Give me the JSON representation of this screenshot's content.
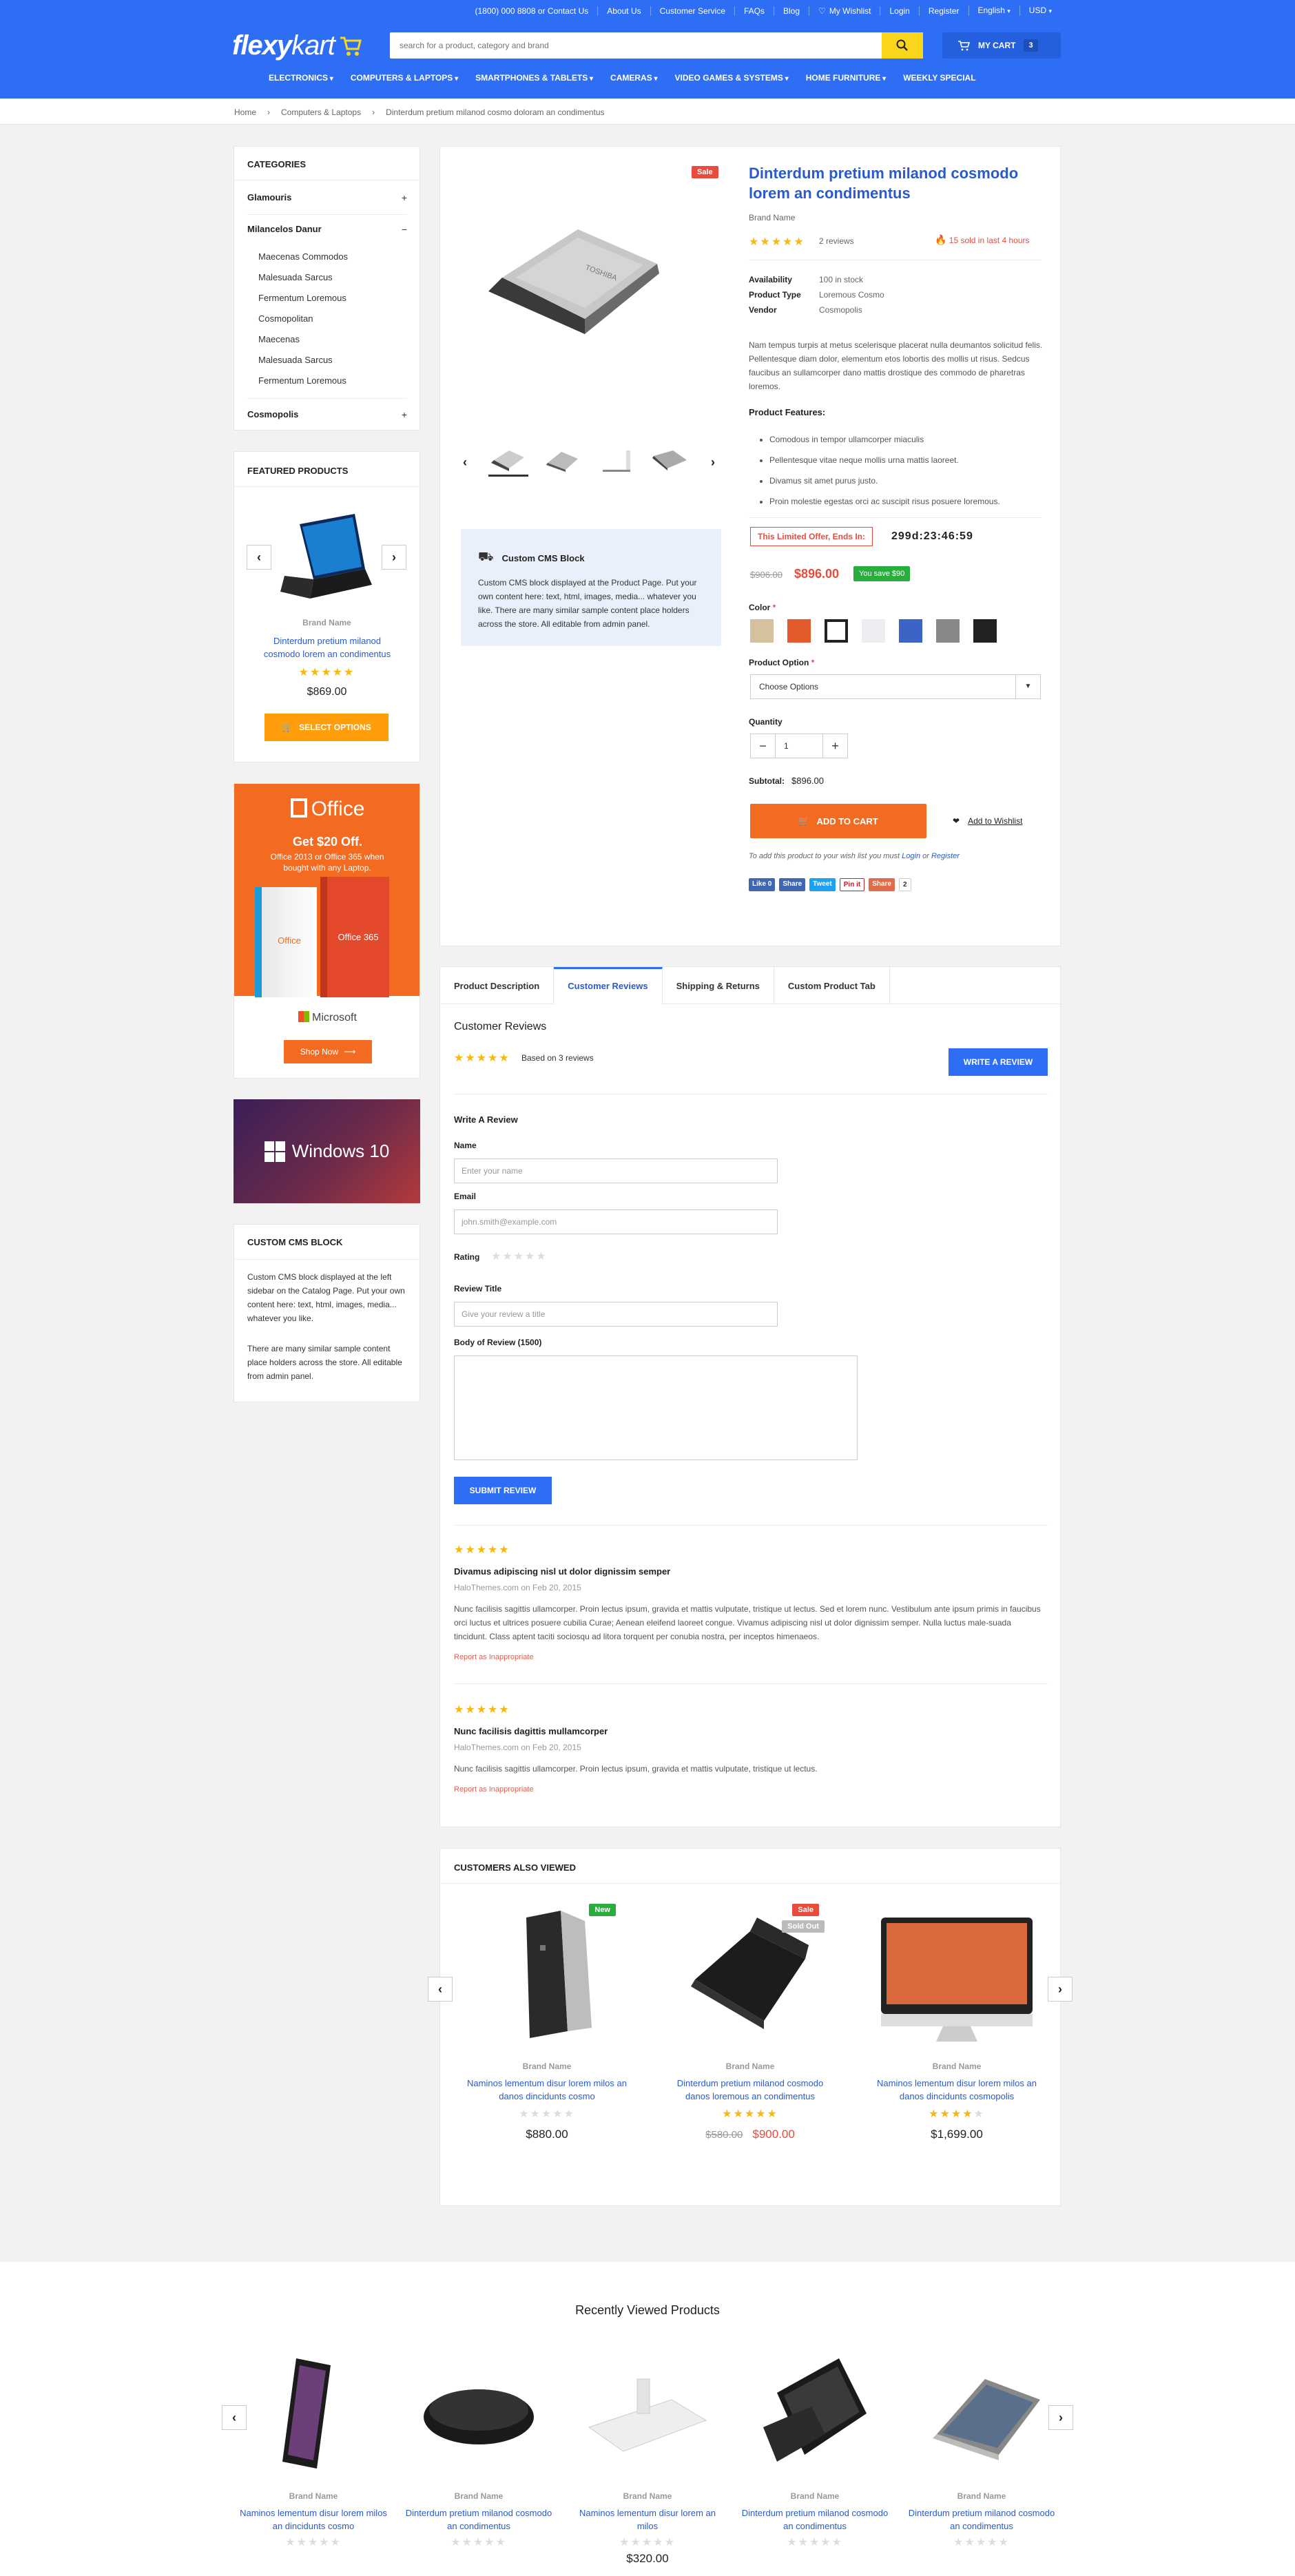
{
  "topbar": {
    "phone": "(1800) 000 8808 or Contact Us",
    "about": "About Us",
    "service": "Customer Service",
    "faqs": "FAQs",
    "blog": "Blog",
    "wishlist": "My Wishlist",
    "login": "Login",
    "register": "Register",
    "language": "English",
    "currency": "USD"
  },
  "logo": {
    "text_a": "flexy",
    "text_b": "kart"
  },
  "search": {
    "placeholder": "search for a product, category and brand"
  },
  "cart": {
    "label": "MY CART",
    "count": "3"
  },
  "nav": [
    "ELECTRONICS",
    "COMPUTERS & LAPTOPS",
    "SMARTPHONES & TABLETS",
    "CAMERAS",
    "VIDEO GAMES & SYSTEMS",
    "HOME FURNITURE",
    "WEEKLY SPECIAL"
  ],
  "breadcrumb": [
    "Home",
    "Computers & Laptops",
    "Dinterdum pretium milanod cosmo doloram an condimentus"
  ],
  "categories": {
    "title": "CATEGORIES",
    "items": [
      {
        "label": "Glamouris",
        "toggle": "+"
      },
      {
        "label": "Milancelos Danur",
        "toggle": "−"
      },
      {
        "label": "Cosmopolis",
        "toggle": "+"
      }
    ],
    "sub": [
      "Maecenas Commodos",
      "Malesuada Sarcus",
      "Fermentum Loremous",
      "Cosmopolitan",
      "Maecenas",
      "Malesuada Sarcus",
      "Fermentum Loremous"
    ]
  },
  "featured": {
    "title": "FEATURED PRODUCTS",
    "brand": "Brand Name",
    "name": "Dinterdum pretium milanod cosmodo lorem an condimentus",
    "price": "$869.00",
    "button": "SELECT OPTIONS"
  },
  "office_banner": {
    "logo": "Office",
    "headline": "Get $20 Off.",
    "sub": "Office 2013 or Office 365 when bought with any Laptop.",
    "box_a": "Office",
    "box_b": "Office 365",
    "microsoft": "Microsoft",
    "button": "Shop Now"
  },
  "windows_banner": {
    "text": "Windows 10"
  },
  "cms_left": {
    "title": "CUSTOM CMS BLOCK",
    "p1": "Custom CMS block displayed at the left sidebar on the Catalog Page. Put your own content here: text, html, images, media... whatever you like.",
    "p2": "There are many similar sample content place holders across the store. All editable from admin panel."
  },
  "product": {
    "sale": "Sale",
    "title": "Dinterdum pretium milanod cosmodo lorem an condimentus",
    "brand": "Brand Name",
    "reviews": "2 reviews",
    "sold": "15 sold in last 4 hours",
    "availability_label": "Availability",
    "availability": "100 in stock",
    "type_label": "Product Type",
    "type": "Loremous Cosmo",
    "vendor_label": "Vendor",
    "vendor": "Cosmopolis",
    "description": "Nam tempus turpis at metus scelerisque placerat nulla deumantos solicitud felis. Pellentesque diam dolor, elementum etos lobortis des mollis ut risus. Sedcus faucibus an sullamcorper dano mattis drostique des commodo de pharetras loremos.",
    "features_title": "Product Features:",
    "features": [
      "Comodous in tempor ullamcorper miaculis",
      "Pellentesque vitae neque mollis urna mattis laoreet.",
      "Divamus sit amet purus justo.",
      "Proin molestie egestas orci ac suscipit risus posuere loremous."
    ],
    "offer_label": "This Limited Offer, Ends In:",
    "countdown": "299d:23:46:59",
    "old_price": "$906.00",
    "price": "$896.00",
    "save": "You save $90",
    "color_label": "Color",
    "colors": [
      "#d6c19e",
      "#e35a2c",
      "#ffffff",
      "#eeeef2",
      "#3d63c7",
      "#888888",
      "#222222"
    ],
    "option_label": "Product Option",
    "option_value": "Choose Options",
    "qty_label": "Quantity",
    "qty": "1",
    "subtotal_label": "Subtotal:",
    "subtotal": "$896.00",
    "add_to_cart": "ADD TO CART",
    "wishlist": "Add to Wishlist",
    "wish_note_a": "To add this product to your wish list you must",
    "wish_login": "Login",
    "wish_or": "or",
    "wish_register": "Register",
    "social": [
      "Like 0",
      "Share",
      "Tweet",
      "Pin it",
      "Share",
      "2"
    ]
  },
  "cms_center": {
    "title": "Custom CMS Block",
    "text": "Custom CMS block displayed at the Product Page. Put your own content here: text, html, images, media... whatever you like. There are many similar sample content place holders across the store. All editable from admin panel."
  },
  "tabs": [
    "Product Description",
    "Customer Reviews",
    "Shipping & Returns",
    "Custom Product Tab"
  ],
  "reviews": {
    "title": "Customer Reviews",
    "based": "Based on 3 reviews",
    "write_button": "WRITE A REVIEW",
    "form_title": "Write A Review",
    "name_label": "Name",
    "name_ph": "Enter your name",
    "email_label": "Email",
    "email_ph": "john.smith@example.com",
    "rating_label": "Rating",
    "review_title_label": "Review Title",
    "review_title_ph": "Give your review a title",
    "body_label": "Body of Review (1500)",
    "submit": "SUBMIT REVIEW",
    "list": [
      {
        "title": "Divamus adipiscing nisl ut dolor dignissim semper",
        "meta": "HaloThemes.com on Feb 20, 2015",
        "text": "Nunc facilisis sagittis ullamcorper. Proin lectus ipsum, gravida et mattis vulputate, tristique ut lectus. Sed et lorem nunc. Vestibulum ante ipsum primis in faucibus orci luctus et ultrices posuere cubilia Curae; Aenean eleifend laoreet congue. Vivamus adipiscing nisl ut dolor dignissim semper. Nulla luctus male-suada tincidunt. Class aptent taciti sociosqu ad litora torquent per conubia nostra, per inceptos himenaeos.",
        "report": "Report as Inappropriate"
      },
      {
        "title": "Nunc facilisis dagittis mullamcorper",
        "meta": "HaloThemes.com on Feb 20, 2015",
        "text": "Nunc facilisis sagittis ullamcorper. Proin lectus ipsum, gravida et mattis vulputate, tristique ut lectus.",
        "report": "Report as Inappropriate"
      }
    ]
  },
  "also_viewed": {
    "title": "CUSTOMERS ALSO VIEWED",
    "items": [
      {
        "badge": "New",
        "brand": "Brand Name",
        "name": "Naminos lementum disur lorem milos an danos dincidunts cosmo",
        "price": "$880.00",
        "old": "",
        "rating": "0"
      },
      {
        "badge": "Sale",
        "badge2": "Sold Out",
        "brand": "Brand Name",
        "name": "Dinterdum pretium milanod cosmodo danos loremous an condimentus",
        "price": "$900.00",
        "old": "$580.00",
        "rating": "5"
      },
      {
        "badge": "",
        "brand": "Brand Name",
        "name": "Naminos lementum disur lorem milos an danos dincidunts cosmopolis",
        "price": "$1,699.00",
        "old": "",
        "rating": "4"
      }
    ]
  },
  "recently": {
    "title": "Recently Viewed Products",
    "items": [
      {
        "brand": "Brand Name",
        "name": "Naminos lementum disur lorem milos an dincidunts cosmo",
        "price": ""
      },
      {
        "brand": "Brand Name",
        "name": "Dinterdum pretium milanod cosmodo an condimentus",
        "price": ""
      },
      {
        "brand": "Brand Name",
        "name": "Naminos lementum disur lorem an milos",
        "price": "$320.00"
      },
      {
        "brand": "Brand Name",
        "name": "Dinterdum pretium milanod cosmodo an condimentus",
        "price": ""
      },
      {
        "brand": "Brand Name",
        "name": "Dinterdum pretium milanod cosmodo an condimentus",
        "price": ""
      }
    ]
  }
}
